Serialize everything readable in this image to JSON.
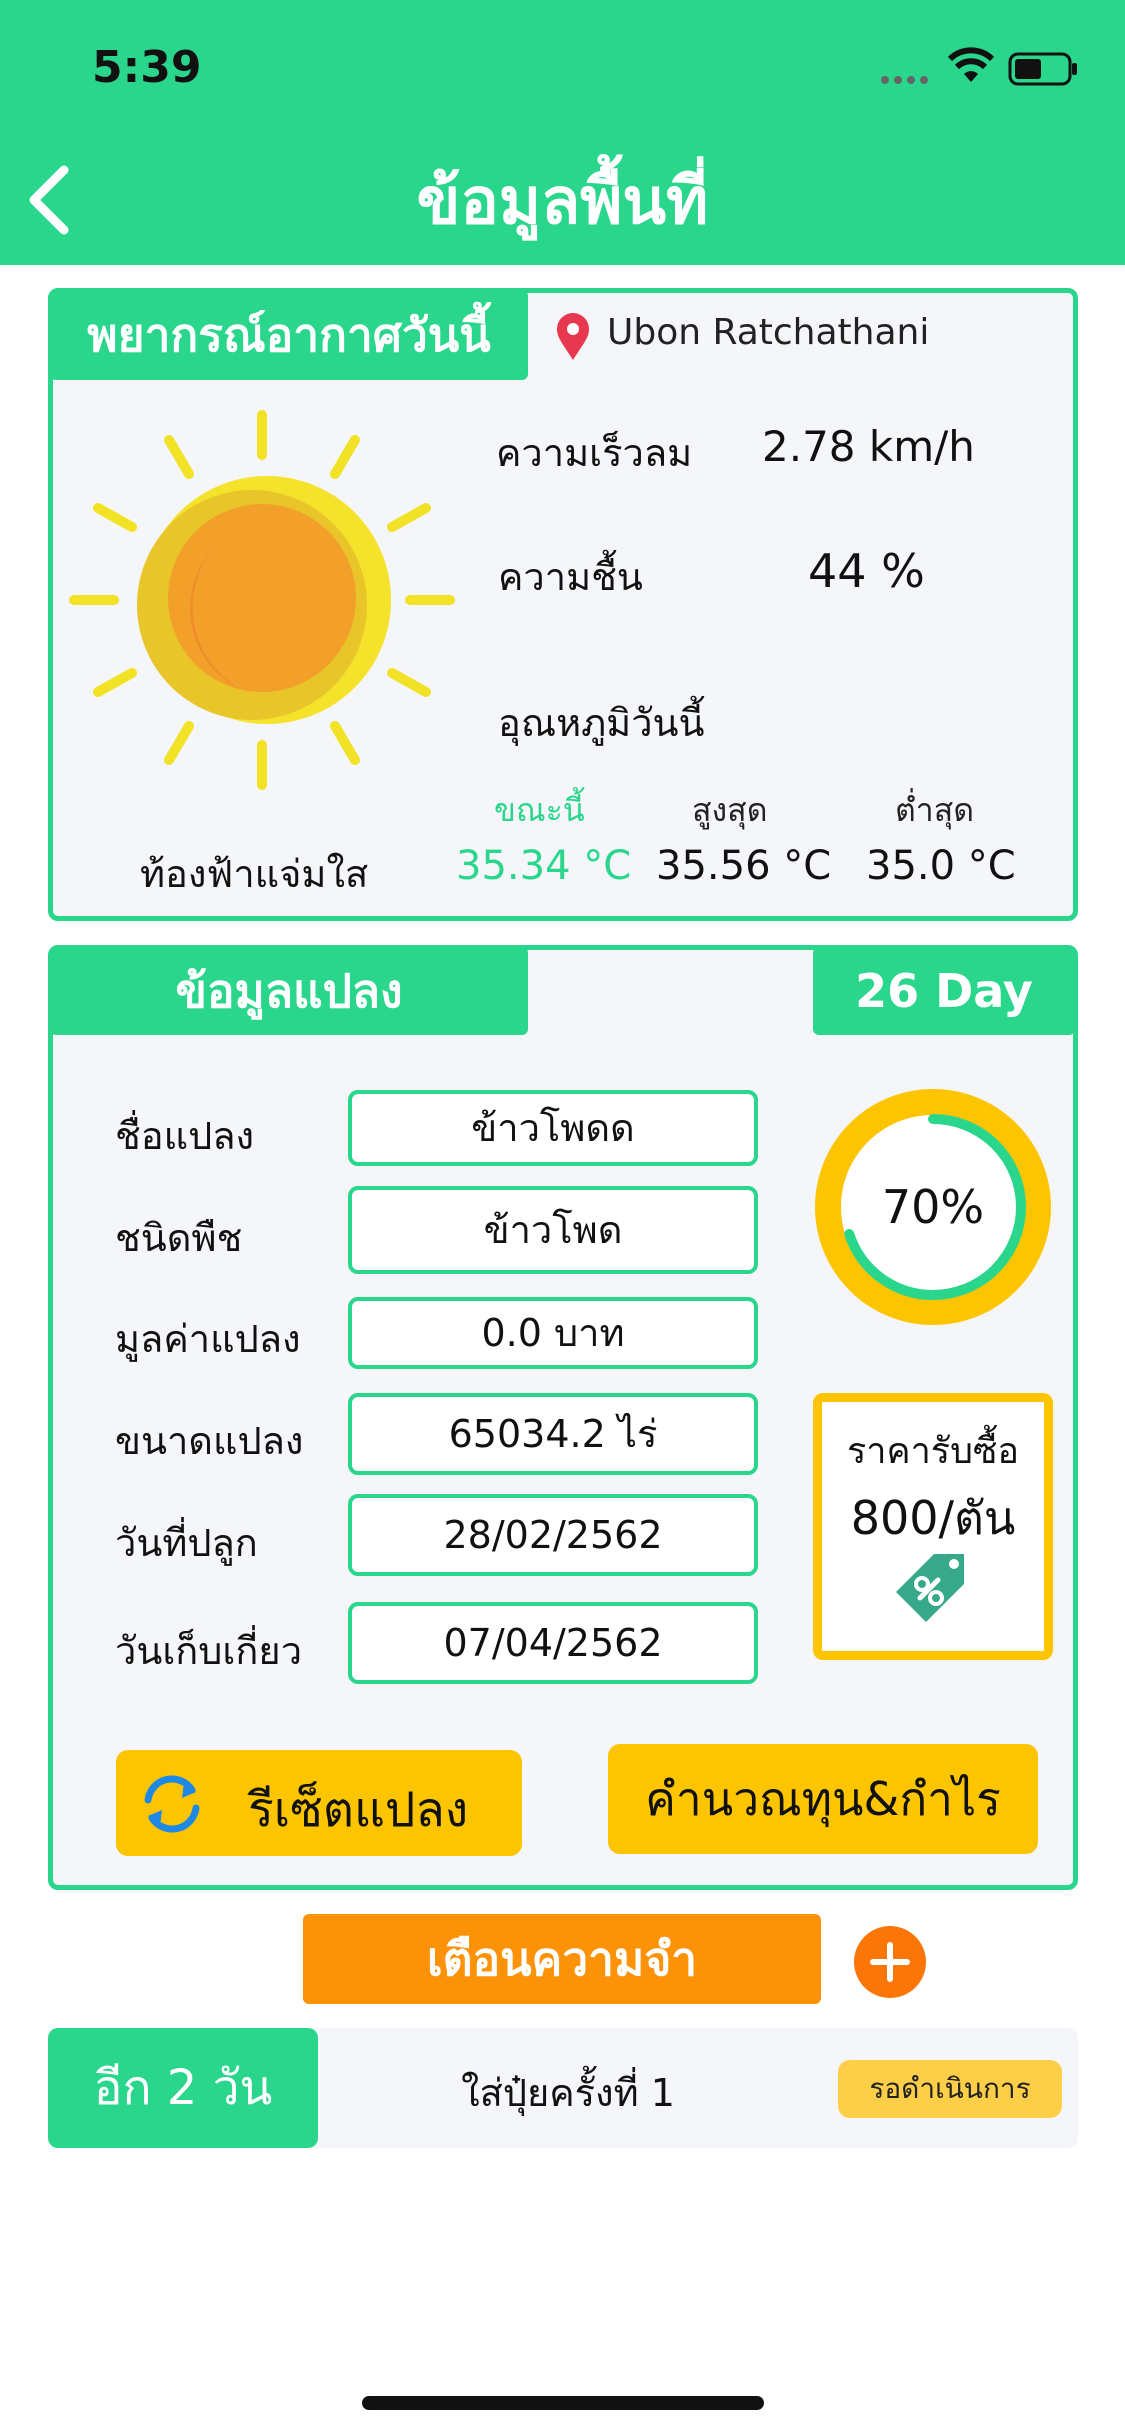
{
  "status_bar": {
    "time": "5:39"
  },
  "header": {
    "title": "ข้อมูลพื้นที่"
  },
  "weather": {
    "tab_label": "พยากรณ์อากาศวันนี้",
    "location": "Ubon Ratchathani",
    "wind_label": "ความเร็วลม",
    "wind_value": "2.78 km/h",
    "humidity_label": "ความชื้น",
    "humidity_value": "44 %",
    "temp_label": "อุณหภูมิวันนี้",
    "now_label": "ขณะนี้",
    "high_label": "สูงสุด",
    "low_label": "ต่ำสุด",
    "now_value": "35.34 °C",
    "high_value": "35.56 °C",
    "low_value": "35.0 °C",
    "condition": "ท้องฟ้าแจ่มใส"
  },
  "plot": {
    "tab_label": "ข้อมูลแปลง",
    "day_badge": "26 Day",
    "fields": [
      {
        "label": "ชื่อแปลง",
        "value": "ข้าวโพดด"
      },
      {
        "label": "ชนิดพืช",
        "value": "ข้าวโพด"
      },
      {
        "label": "มูลค่าแปลง",
        "value": "0.0 บาท"
      },
      {
        "label": "ขนาดแปลง",
        "value": "65034.2 ไร่"
      },
      {
        "label": "วันที่ปลูก",
        "value": "28/02/2562"
      },
      {
        "label": "วันเก็บเกี่ยว",
        "value": "07/04/2562"
      }
    ],
    "progress_text": "70%",
    "progress_fraction": 0.7,
    "price_label": "ราคารับซื้อ",
    "price_value": "800/ตัน",
    "reset_label": "รีเซ็ตแปลง",
    "calc_label": "คำนวณทุน&กำไร"
  },
  "reminder": {
    "button_label": "เตือนความจำ",
    "items": [
      {
        "days_left": "อีก 2 วัน",
        "task": "ใส่ปุ๋ยครั้งที่ 1",
        "status": "รอดำเนินการ"
      }
    ]
  },
  "colors": {
    "primary": "#2ad68c",
    "yellow": "#fdc500",
    "orange": "#fb9207"
  }
}
